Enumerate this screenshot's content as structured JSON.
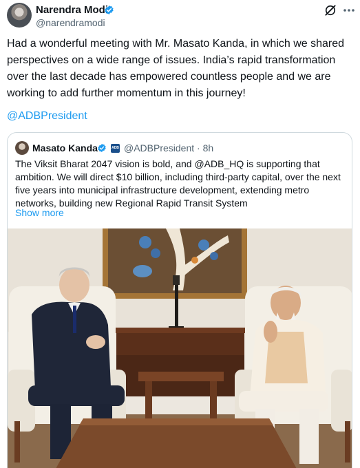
{
  "post": {
    "author_name": "Narendra Modi",
    "author_handle": "@narendramodi",
    "text": "Had a wonderful meeting with Mr. Masato Kanda, in which we shared perspectives on a wide range of issues. India’s rapid transformation over the last decade has empowered countless people and we are working to add further momentum in this journey!",
    "mention": "@ADBPresident"
  },
  "quote": {
    "author_name": "Masato Kanda",
    "affiliate_badge": "ADB",
    "author_handle": "@ADBPresident",
    "separator": "·",
    "time": "8h",
    "text": "The Viksit Bharat 2047 vision is bold, and @ADB_HQ is supporting that ambition. We will direct $10 billion, including third-party capital, over the next five years into municipal infrastructure development, extending metro networks, building new Regional Rapid Transit System",
    "show_more": "Show more"
  },
  "colors": {
    "link": "#1d9bf0",
    "verified": "#1d9bf0",
    "secondary_text": "#536471",
    "border": "#cfd9de"
  },
  "icons": [
    "verified-badge-icon",
    "grok-icon",
    "more-options-icon",
    "adb-affiliate-icon"
  ]
}
